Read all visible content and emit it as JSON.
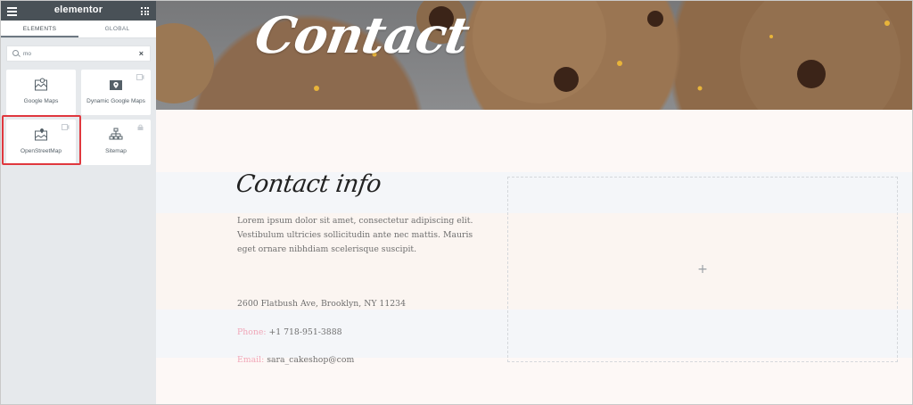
{
  "sidebar": {
    "brand": "elementor",
    "tabs": [
      {
        "label": "ELEMENTS",
        "active": true
      },
      {
        "label": "GLOBAL",
        "active": false
      }
    ],
    "search": {
      "value": "mo"
    },
    "widgets": [
      {
        "label": "Google Maps",
        "icon": "map-icon",
        "pro": false
      },
      {
        "label": "Dynamic Google Maps",
        "icon": "map-pin-icon",
        "pro": true
      },
      {
        "label": "OpenStreetMap",
        "icon": "map-location-icon",
        "pro": true,
        "highlighted": true
      },
      {
        "label": "Sitemap",
        "icon": "sitemap-icon",
        "pro": true
      }
    ]
  },
  "canvas": {
    "hero_title": "Contact",
    "heading": "Contact info",
    "body": "Lorem ipsum dolor sit amet, consectetur adipiscing elit. Vestibulum ultricies sollicitudin ante nec mattis. Mauris eget ornare nibhdiam scelerisque suscipit.",
    "address": "2600 Flatbush Ave, Brooklyn, NY 11234",
    "phone_label": "Phone:",
    "phone": "+1 718-951-3888",
    "email_label": "Email:",
    "email": "sara_cakeshop@com",
    "drop_zone_symbol": "+"
  },
  "colors": {
    "sidebar_topbar": "#495157",
    "sidebar_bg": "#e6e9ec",
    "highlight": "#e0383e",
    "accent_label": "#f0a6b8"
  }
}
